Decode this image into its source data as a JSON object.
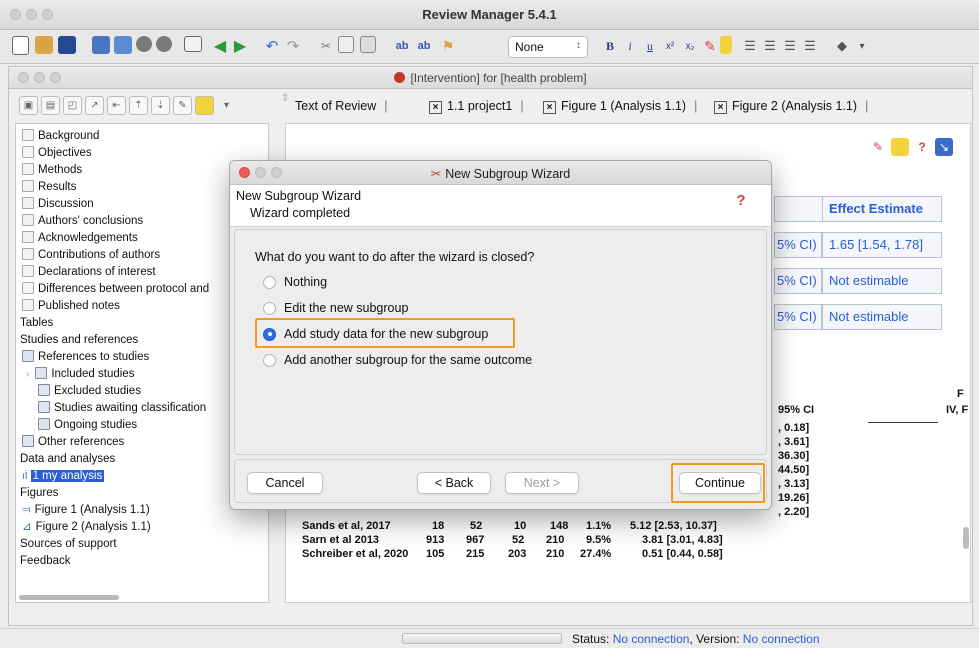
{
  "app": {
    "title": "Review Manager 5.4.1"
  },
  "toolbar": {
    "style_value": "None",
    "style_arrow": "↕"
  },
  "document": {
    "title": "[Intervention] for [health problem]"
  },
  "tabs": [
    {
      "label": "Text of Review"
    },
    {
      "label": "1.1 project1"
    },
    {
      "label": "Figure 1 (Analysis 1.1)"
    },
    {
      "label": "Figure 2 (Analysis 1.1)"
    }
  ],
  "tree": {
    "items": [
      {
        "label": "Background"
      },
      {
        "label": "Objectives"
      },
      {
        "label": "Methods"
      },
      {
        "label": "Results"
      },
      {
        "label": "Discussion"
      },
      {
        "label": "Authors' conclusions"
      },
      {
        "label": "Acknowledgements"
      },
      {
        "label": "Contributions of authors"
      },
      {
        "label": "Declarations of interest"
      },
      {
        "label": "Differences between protocol and"
      },
      {
        "label": "Published notes"
      },
      {
        "label": "Tables"
      },
      {
        "label": "Studies and references"
      },
      {
        "label": "References to studies"
      },
      {
        "label": "Included studies"
      },
      {
        "label": "Excluded studies"
      },
      {
        "label": "Studies awaiting classification"
      },
      {
        "label": "Ongoing studies"
      },
      {
        "label": "Other references"
      },
      {
        "label": "Data and analyses"
      },
      {
        "label": "1 my analysis"
      },
      {
        "label": "Figures"
      },
      {
        "label": "Figure 1 (Analysis 1.1)"
      },
      {
        "label": "Figure 2 (Analysis 1.1)"
      },
      {
        "label": "Sources of support"
      },
      {
        "label": "Feedback"
      }
    ]
  },
  "content": {
    "effect_header": "Effect Estimate",
    "effect_rows": [
      {
        "ci": "5% CI)",
        "value": "1.65 [1.54, 1.78]"
      },
      {
        "ci": "5% CI)",
        "value": "Not estimable"
      },
      {
        "ci": "5% CI)",
        "value": "Not estimable"
      }
    ],
    "forest_head": {
      "ci": "95% CI",
      "right": "IV, F",
      "top_right": "F"
    },
    "ci_fragments": [
      ", 0.18]",
      ", 3.61]",
      "36.30]",
      "44.50]",
      ", 3.13]",
      "19.26]",
      ", 2.20]"
    ],
    "rows": [
      {
        "study": "Sands et al, 2017",
        "c1": "18",
        "c2": "52",
        "c3": "10",
        "c4": "148",
        "w": "1.1%",
        "ci": "5.12 [2.53, 10.37]"
      },
      {
        "study": "Sarn et al 2013",
        "c1": "913",
        "c2": "967",
        "c3": "52",
        "c4": "210",
        "w": "9.5%",
        "ci": "3.81 [3.01, 4.83]"
      },
      {
        "study": "Schreiber et al, 2020",
        "c1": "105",
        "c2": "215",
        "c3": "203",
        "c4": "210",
        "w": "27.4%",
        "ci": "0.51 [0.44, 0.58]"
      }
    ]
  },
  "dialog": {
    "title": "New Subgroup Wizard",
    "heading": "New Subgroup Wizard",
    "subheading": "Wizard completed",
    "help_icon": "?",
    "question": "What do you want to do after the wizard is closed?",
    "options": [
      {
        "label": "Nothing",
        "selected": false
      },
      {
        "label": "Edit the new subgroup",
        "selected": false
      },
      {
        "label": "Add study data for the new subgroup",
        "selected": true
      },
      {
        "label": "Add another subgroup for the same outcome",
        "selected": false
      }
    ],
    "buttons": {
      "cancel": "Cancel",
      "back": "< Back",
      "next": "Next >",
      "continue": "Continue"
    }
  },
  "status": {
    "label": "Status:",
    "status_value": "No connection",
    "version_label": ", Version:",
    "version_value": "No connection"
  },
  "colors": {
    "accent": "#2a5fd6",
    "highlight": "#f39a1c"
  }
}
